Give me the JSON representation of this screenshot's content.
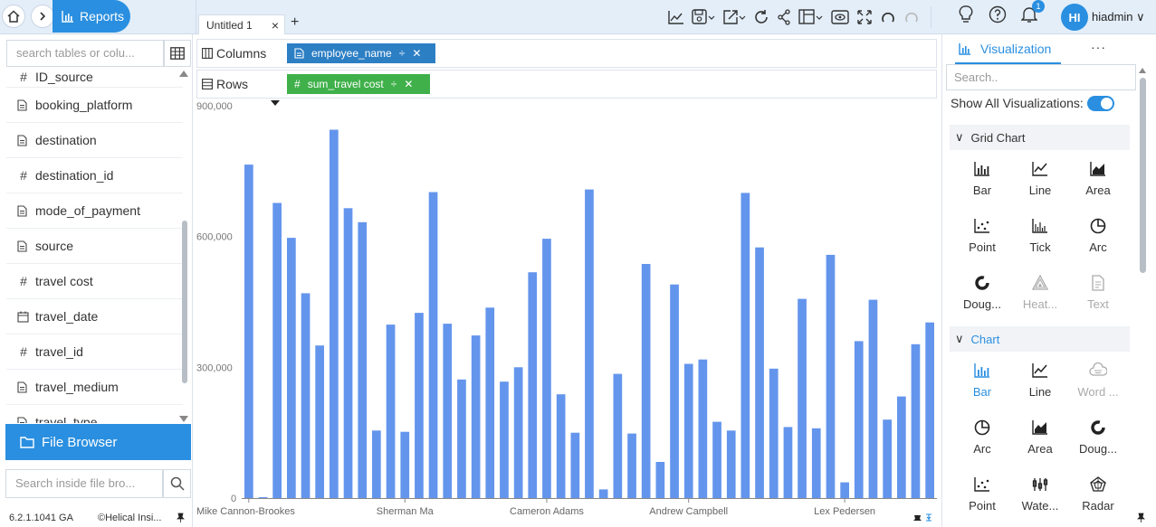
{
  "topbar": {
    "reports_label": "Reports",
    "tab_title": "Untitled 1",
    "tab_close": "×",
    "tab_add": "+",
    "user_initials": "HI",
    "username": "hiadmin",
    "notification_count": "1"
  },
  "left": {
    "search_placeholder": "search tables or colu...",
    "fields": [
      {
        "type": "#",
        "name": "ID_source"
      },
      {
        "type": "doc",
        "name": "booking_platform"
      },
      {
        "type": "doc",
        "name": "destination"
      },
      {
        "type": "#",
        "name": "destination_id"
      },
      {
        "type": "doc",
        "name": "mode_of_payment"
      },
      {
        "type": "doc",
        "name": "source"
      },
      {
        "type": "#",
        "name": "travel cost"
      },
      {
        "type": "cal",
        "name": "travel_date"
      },
      {
        "type": "#",
        "name": "travel_id"
      },
      {
        "type": "doc",
        "name": "travel_medium"
      },
      {
        "type": "doc",
        "name": "travel_type"
      }
    ],
    "file_browser_label": "File Browser",
    "file_search_placeholder": "Search inside file bro...",
    "version": "6.2.1.1041 GA",
    "copyright": "©Helical Insi..."
  },
  "shelves": {
    "columns_label": "Columns",
    "rows_label": "Rows",
    "column_pill": "employee_name",
    "row_pill": "sum_travel cost"
  },
  "right": {
    "viz_tab_label": "Visualization",
    "more_label": "···",
    "search_placeholder": "Search..",
    "show_all_label": "Show All Visualizations:",
    "grid_chart_label": "Grid Chart",
    "chart_label": "Chart",
    "grid_items": [
      {
        "icon": "bar-icon",
        "label": "Bar",
        "state": "normal"
      },
      {
        "icon": "line-icon",
        "label": "Line",
        "state": "normal"
      },
      {
        "icon": "area-icon",
        "label": "Area",
        "state": "normal"
      },
      {
        "icon": "point-icon",
        "label": "Point",
        "state": "normal"
      },
      {
        "icon": "tick-icon",
        "label": "Tick",
        "state": "normal"
      },
      {
        "icon": "arc-icon",
        "label": "Arc",
        "state": "normal"
      },
      {
        "icon": "doughnut-icon",
        "label": "Doug...",
        "state": "normal"
      },
      {
        "icon": "heatmap-icon",
        "label": "Heat...",
        "state": "disabled"
      },
      {
        "icon": "text-icon",
        "label": "Text",
        "state": "disabled"
      }
    ],
    "chart_items": [
      {
        "icon": "bar-icon",
        "label": "Bar",
        "state": "active"
      },
      {
        "icon": "line-icon",
        "label": "Line",
        "state": "normal"
      },
      {
        "icon": "wordcloud-icon",
        "label": "Word ...",
        "state": "disabled"
      },
      {
        "icon": "arc-icon",
        "label": "Arc",
        "state": "normal"
      },
      {
        "icon": "area-icon",
        "label": "Area",
        "state": "normal"
      },
      {
        "icon": "doughnut-icon",
        "label": "Doug...",
        "state": "normal"
      },
      {
        "icon": "point-icon",
        "label": "Point",
        "state": "normal"
      },
      {
        "icon": "waterfall-icon",
        "label": "Wate...",
        "state": "normal"
      },
      {
        "icon": "radar-icon",
        "label": "Radar",
        "state": "normal"
      }
    ]
  },
  "colors": {
    "accent": "#2a8fe0",
    "bar": "#6495ed",
    "pill_column": "#2d7fc4",
    "pill_row": "#3fb04a"
  },
  "chart_data": {
    "type": "bar",
    "ylim": [
      0,
      900000
    ],
    "y_ticks": [
      {
        "value": 0,
        "label": "0"
      },
      {
        "value": 300000,
        "label": "300,000"
      },
      {
        "value": 600000,
        "label": "600,000"
      },
      {
        "value": 900000,
        "label": "900,000"
      }
    ],
    "x_tick_labels": [
      {
        "index": 0,
        "label": "Mike Cannon-Brookes"
      },
      {
        "index": 11,
        "label": "Sherman Ma"
      },
      {
        "index": 21,
        "label": "Cameron Adams"
      },
      {
        "index": 31,
        "label": "Andrew Campbell"
      },
      {
        "index": 42,
        "label": "Lex Pedersen"
      }
    ],
    "values": [
      765000,
      2000,
      677000,
      597000,
      470000,
      350000,
      845000,
      665000,
      633000,
      155000,
      398000,
      152000,
      425000,
      702000,
      400000,
      272000,
      373000,
      437000,
      267000,
      300000,
      518000,
      595000,
      238000,
      150000,
      708000,
      20000,
      285000,
      148000,
      537000,
      83000,
      490000,
      308000,
      318000,
      175000,
      155000,
      700000,
      575000,
      297000,
      163000,
      457000,
      160000,
      558000,
      36000,
      360000,
      455000,
      180000,
      233000,
      353000,
      403000
    ]
  }
}
